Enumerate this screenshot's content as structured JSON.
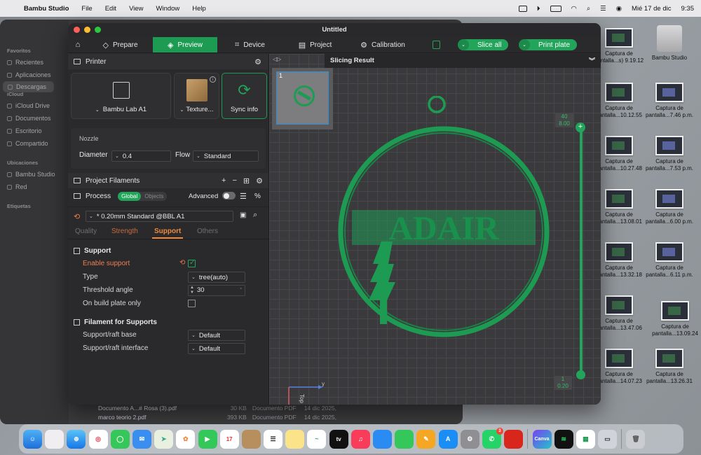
{
  "menubar": {
    "app_name": "Bambu Studio",
    "menus": [
      "File",
      "Edit",
      "View",
      "Window",
      "Help"
    ],
    "date": "Mié 17 de dic",
    "time": "9:35"
  },
  "finder": {
    "favorites_title": "Favoritos",
    "favorites": [
      "Recientes",
      "Aplicaciones",
      "Descargas"
    ],
    "icloud_title": "iCloud",
    "icloud": [
      "iCloud Drive",
      "Documentos",
      "Escritorio",
      "Compartido"
    ],
    "locations_title": "Ubicaciones",
    "locations": [
      "Bambu Studio",
      "Red"
    ],
    "tags_title": "Etiquetas",
    "files": [
      {
        "name": "Documento A...# Rosa (3).pdf",
        "size": "30 KB",
        "kind": "Documento PDF",
        "date": "14 dic 2025,"
      },
      {
        "name": "marco teorio 2.pdf",
        "size": "393 KB",
        "kind": "Documento PDF",
        "date": "14 dic 2025,"
      }
    ]
  },
  "desktop": {
    "icons": [
      {
        "label": "Captura de pantalla...s) 9.19.12"
      },
      {
        "label": "Bambu Studio"
      },
      {
        "label": "Captura de pantalla...10.12.55"
      },
      {
        "label": "Captura de pantalla...7.46 p.m."
      },
      {
        "label": "Captura de pantalla...10.27.48"
      },
      {
        "label": "Captura de pantalla...7.53 p.m."
      },
      {
        "label": "Captura de pantalla...13.08.01"
      },
      {
        "label": "Captura de pantalla...6.00 p.m."
      },
      {
        "label": "Captura de pantalla...13.32.18"
      },
      {
        "label": "Captura de pantalla...6.11 p.m."
      },
      {
        "label": "Captura de pantalla...13.47.06"
      },
      {
        "label": "Captura de pantalla...13.09.24"
      },
      {
        "label": "Captura de pantalla...14.07.23"
      },
      {
        "label": "Captura de pantalla...13.26.31"
      }
    ]
  },
  "window": {
    "title": "Untitled"
  },
  "tabs": {
    "prepare": "Prepare",
    "preview": "Preview",
    "device": "Device",
    "project": "Project",
    "calibration": "Calibration",
    "slice_all": "Slice all",
    "print_plate": "Print plate"
  },
  "printer": {
    "section_title": "Printer",
    "printer_name": "Bambu Lab A1",
    "plate_type": "Texture...",
    "sync_info": "Sync info",
    "nozzle_title": "Nozzle",
    "diameter_label": "Diameter",
    "diameter_value": "0.4",
    "flow_label": "Flow",
    "flow_value": "Standard"
  },
  "filaments": {
    "title": "Project Filaments"
  },
  "process": {
    "title": "Process",
    "scope_global": "Global",
    "scope_objects": "Objects",
    "advanced_label": "Advanced",
    "preset": "* 0.20mm Standard @BBL A1",
    "subtabs": [
      "Quality",
      "Strength",
      "Support",
      "Others"
    ]
  },
  "support": {
    "group_title": "Support",
    "enable_label": "Enable support",
    "enable_checked": true,
    "type_label": "Type",
    "type_value": "tree(auto)",
    "threshold_label": "Threshold angle",
    "threshold_value": "30",
    "threshold_unit": "°",
    "buildplate_label": "On build plate only",
    "filament_group_title": "Filament for Supports",
    "base_label": "Support/raft base",
    "base_value": "Default",
    "interface_label": "Support/raft interface",
    "interface_value": "Default"
  },
  "view": {
    "slicing_result": "Slicing Result",
    "plate_number": "1",
    "model_text": "ADAIR",
    "layer_top_index": "40",
    "layer_top_height": "8.00",
    "layer_bottom_index": "1",
    "layer_bottom_height": "0.20",
    "move_value": "23",
    "axis_y": "y",
    "axis_x": "x",
    "view_top": "Top"
  },
  "colors": {
    "accent": "#22a55b",
    "warning": "#ef7f54",
    "model": "#1e9b53"
  }
}
